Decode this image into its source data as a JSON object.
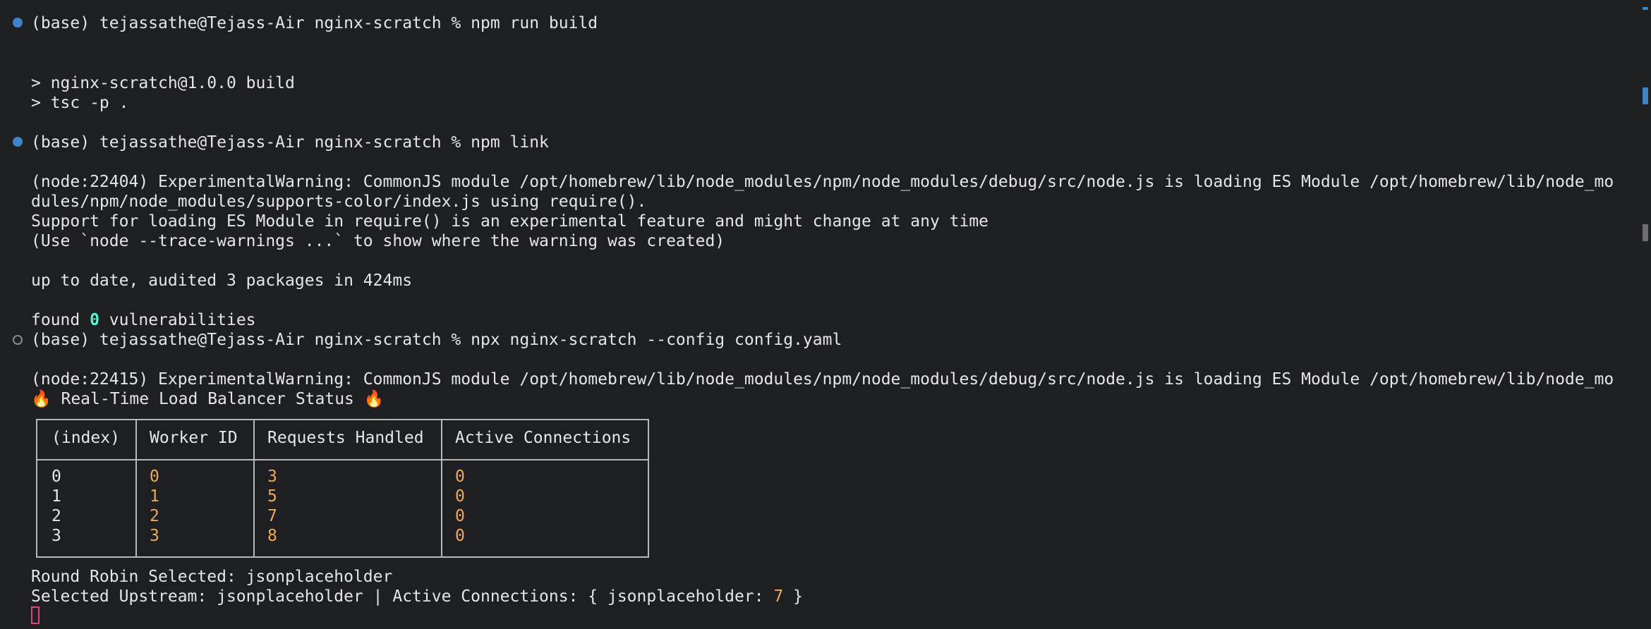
{
  "terminal": {
    "prompt1": "(base) tejassathe@Tejass-Air nginx-scratch % npm run build",
    "build_out1": "> nginx-scratch@1.0.0 build",
    "build_out2": "> tsc -p .",
    "prompt2": "(base) tejassathe@Tejass-Air nginx-scratch % npm link",
    "warn1_line1": "(node:22404) ExperimentalWarning: CommonJS module /opt/homebrew/lib/node_modules/npm/node_modules/debug/src/node.js is loading ES Module /opt/homebrew/lib/node_mo",
    "warn1_line2": "dules/npm/node_modules/supports-color/index.js using require().",
    "warn1_line3": "Support for loading ES Module in require() is an experimental feature and might change at any time",
    "warn1_line4": "(Use `node --trace-warnings ...` to show where the warning was created)",
    "audit": "up to date, audited 3 packages in 424ms",
    "found_prefix": "found ",
    "found_count": "0",
    "found_suffix": " vulnerabilities",
    "prompt3": "(base) tejassathe@Tejass-Air nginx-scratch % npx nginx-scratch --config config.yaml",
    "warn2_line1": "(node:22415) ExperimentalWarning: CommonJS module /opt/homebrew/lib/node_modules/npm/node_modules/debug/src/node.js is loading ES Module /opt/homebrew/lib/node_mo",
    "status_title": "🔥 Real-Time Load Balancer Status 🔥",
    "table": {
      "headers": [
        "(index)",
        "Worker ID",
        "Requests Handled",
        "Active Connections"
      ],
      "rows": [
        [
          "0",
          "0",
          "3",
          "0"
        ],
        [
          "1",
          "1",
          "5",
          "0"
        ],
        [
          "2",
          "2",
          "7",
          "0"
        ],
        [
          "3",
          "3",
          "8",
          "0"
        ]
      ]
    },
    "round_robin": "Round Robin Selected: jsonplaceholder",
    "upstream_prefix": "Selected Upstream: jsonplaceholder | Active Connections: { jsonplaceholder: ",
    "upstream_count": "7",
    "upstream_suffix": " }"
  },
  "colors": {
    "background": "#1e1f22",
    "text": "#e6e6e6",
    "number": "#f0a85a",
    "zero_highlight": "#5cf2d6",
    "prompt_marker": "#3d85c6",
    "cursor": "#e0437a"
  }
}
